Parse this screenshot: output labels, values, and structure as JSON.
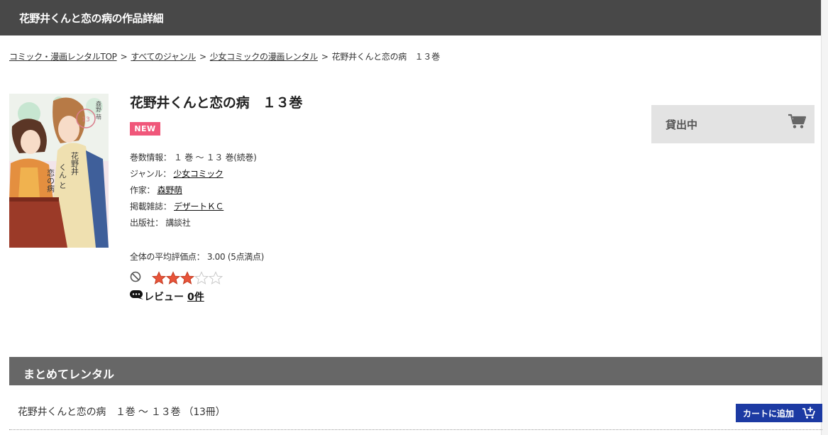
{
  "header": {
    "title": "花野井くんと恋の病の作品詳細"
  },
  "breadcrumb": [
    {
      "label": "コミック・漫画レンタルTOP"
    },
    {
      "label": "すべてのジャンル"
    },
    {
      "label": "少女コミックの漫画レンタル"
    },
    {
      "label": "花野井くんと恋の病　１３巻"
    }
  ],
  "breadcrumb_separator": ">",
  "cover": {
    "author_text": "森野 萌",
    "volume_badge": "13",
    "title_text_col1": "花野井",
    "title_text_col2": "くん と",
    "title_text_col3": "恋の病"
  },
  "book": {
    "title": "花野井くんと恋の病　１３巻",
    "badge": "NEW",
    "volumes_label": "巻数情報：",
    "volumes_value": "１ 巻 ～ １３ 巻(続巻)",
    "genre_label": "ジャンル：",
    "genre_value": "少女コミック",
    "author_label": "作家：",
    "author_value": "森野萌",
    "magazine_label": "掲載雑誌：",
    "magazine_value": "デザートＫＣ",
    "publisher_label": "出版社：",
    "publisher_value": "講談社",
    "rating_label": "全体の平均評価点：",
    "rating_value": "3.00 (5点満点)",
    "rating": 3,
    "rating_max": 5,
    "review_label": "レビュー",
    "review_count": "0件"
  },
  "rent_box": {
    "label": "貸出中",
    "icon": "cart-icon"
  },
  "bundle": {
    "section_title": "まとめてレンタル",
    "text": "花野井くんと恋の病　１巻 ～ １３巻 （13冊）",
    "button_label": "カートに追加",
    "button_icon": "cart-plus-icon"
  },
  "colors": {
    "header_bg": "#484848",
    "badge_new": "#f0577a",
    "section_bar": "#676767",
    "add_cart_button": "#1c3aa3",
    "rent_box_bg": "#e3e3e3",
    "star_filled": "#e8543a"
  }
}
